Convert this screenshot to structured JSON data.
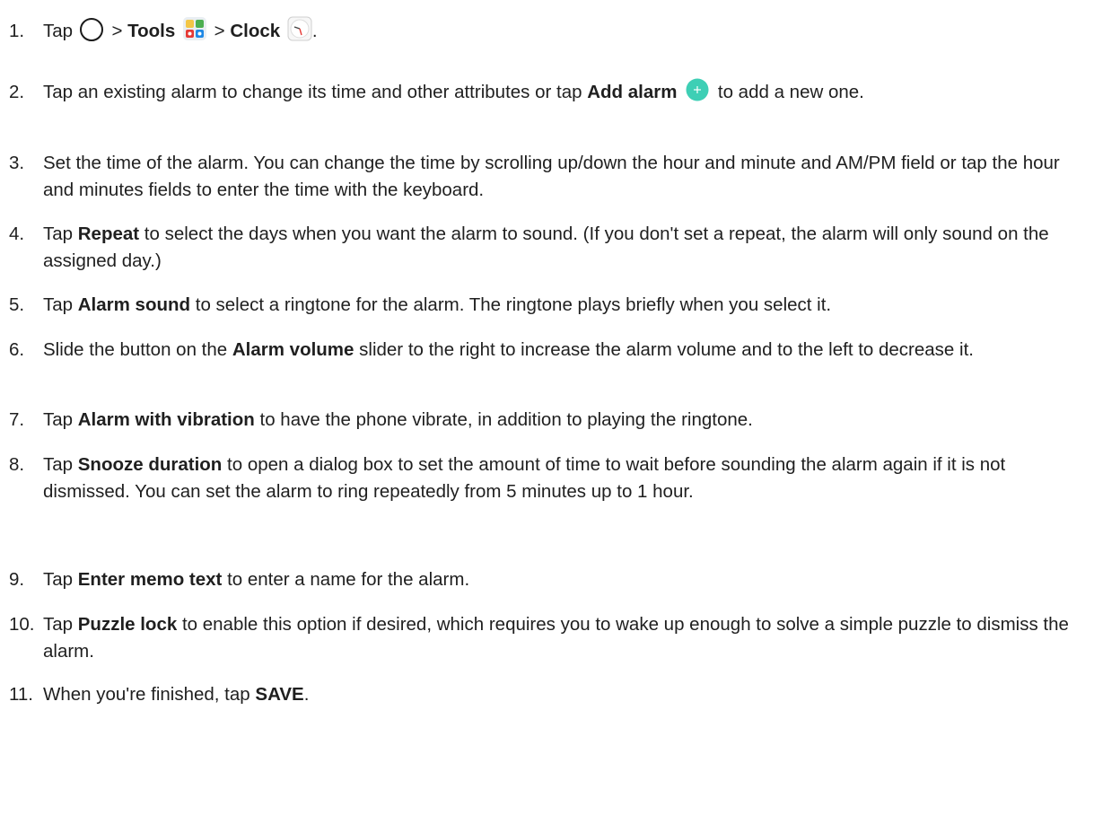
{
  "steps": [
    {
      "num": "1.",
      "parts": [
        {
          "t": "Tap "
        },
        {
          "icon": "home-icon"
        },
        {
          "t": " > "
        },
        {
          "b": "Tools"
        },
        {
          "t": " "
        },
        {
          "icon": "tools-icon"
        },
        {
          "t": " > "
        },
        {
          "b": "Clock"
        },
        {
          "t": " "
        },
        {
          "icon": "clock-icon"
        },
        {
          "t": "."
        }
      ]
    },
    {
      "num": "2.",
      "parts": [
        {
          "t": "Tap an existing alarm to change its time and other attributes or tap "
        },
        {
          "b": "Add alarm"
        },
        {
          "t": " "
        },
        {
          "icon": "add-icon"
        },
        {
          "t": " to add a new one."
        }
      ]
    },
    {
      "num": "3.",
      "parts": [
        {
          "t": "Set the time of the alarm. You can change the time by scrolling up/down the hour and minute and AM/PM field or tap the hour and minutes fields to enter the time with the keyboard."
        }
      ]
    },
    {
      "num": "4.",
      "parts": [
        {
          "t": "Tap "
        },
        {
          "b": "Repeat"
        },
        {
          "t": " to select the days when you want the alarm to sound. (If you don't set a repeat, the alarm will only sound on the assigned day.)"
        }
      ]
    },
    {
      "num": "5.",
      "parts": [
        {
          "t": "Tap "
        },
        {
          "b": "Alarm sound"
        },
        {
          "t": " to select a ringtone for the alarm. The ringtone plays briefly when you select it."
        }
      ]
    },
    {
      "num": "6.",
      "parts": [
        {
          "t": "Slide the button on the "
        },
        {
          "b": "Alarm volume"
        },
        {
          "t": " slider to the right to increase the alarm volume and to the left to decrease it."
        }
      ]
    },
    {
      "num": "7.",
      "parts": [
        {
          "t": "Tap "
        },
        {
          "b": "Alarm with vibration"
        },
        {
          "t": " to have the phone vibrate, in addition to playing the ringtone."
        }
      ]
    },
    {
      "num": "8.",
      "parts": [
        {
          "t": "Tap "
        },
        {
          "b": "Snooze duration"
        },
        {
          "t": " to open a dialog box to set the amount of time to wait before sounding the alarm again if it is not dismissed. You can set the alarm to ring repeatedly from 5 minutes up to 1 hour."
        }
      ]
    },
    {
      "num": "9.",
      "parts": [
        {
          "t": "Tap "
        },
        {
          "b": "Enter memo text"
        },
        {
          "t": " to enter a name for the alarm."
        }
      ]
    },
    {
      "num": "10.",
      "parts": [
        {
          "t": "Tap "
        },
        {
          "b": "Puzzle lock"
        },
        {
          "t": " to enable this option if desired, which requires you to wake up enough to solve a simple puzzle to dismiss the alarm."
        }
      ]
    },
    {
      "num": "11.",
      "parts": [
        {
          "t": "When you're finished, tap "
        },
        {
          "b": "SAVE"
        },
        {
          "t": "."
        }
      ]
    }
  ],
  "colors": {
    "text": "#1f1f1f",
    "accent": "#3ecfb5"
  }
}
